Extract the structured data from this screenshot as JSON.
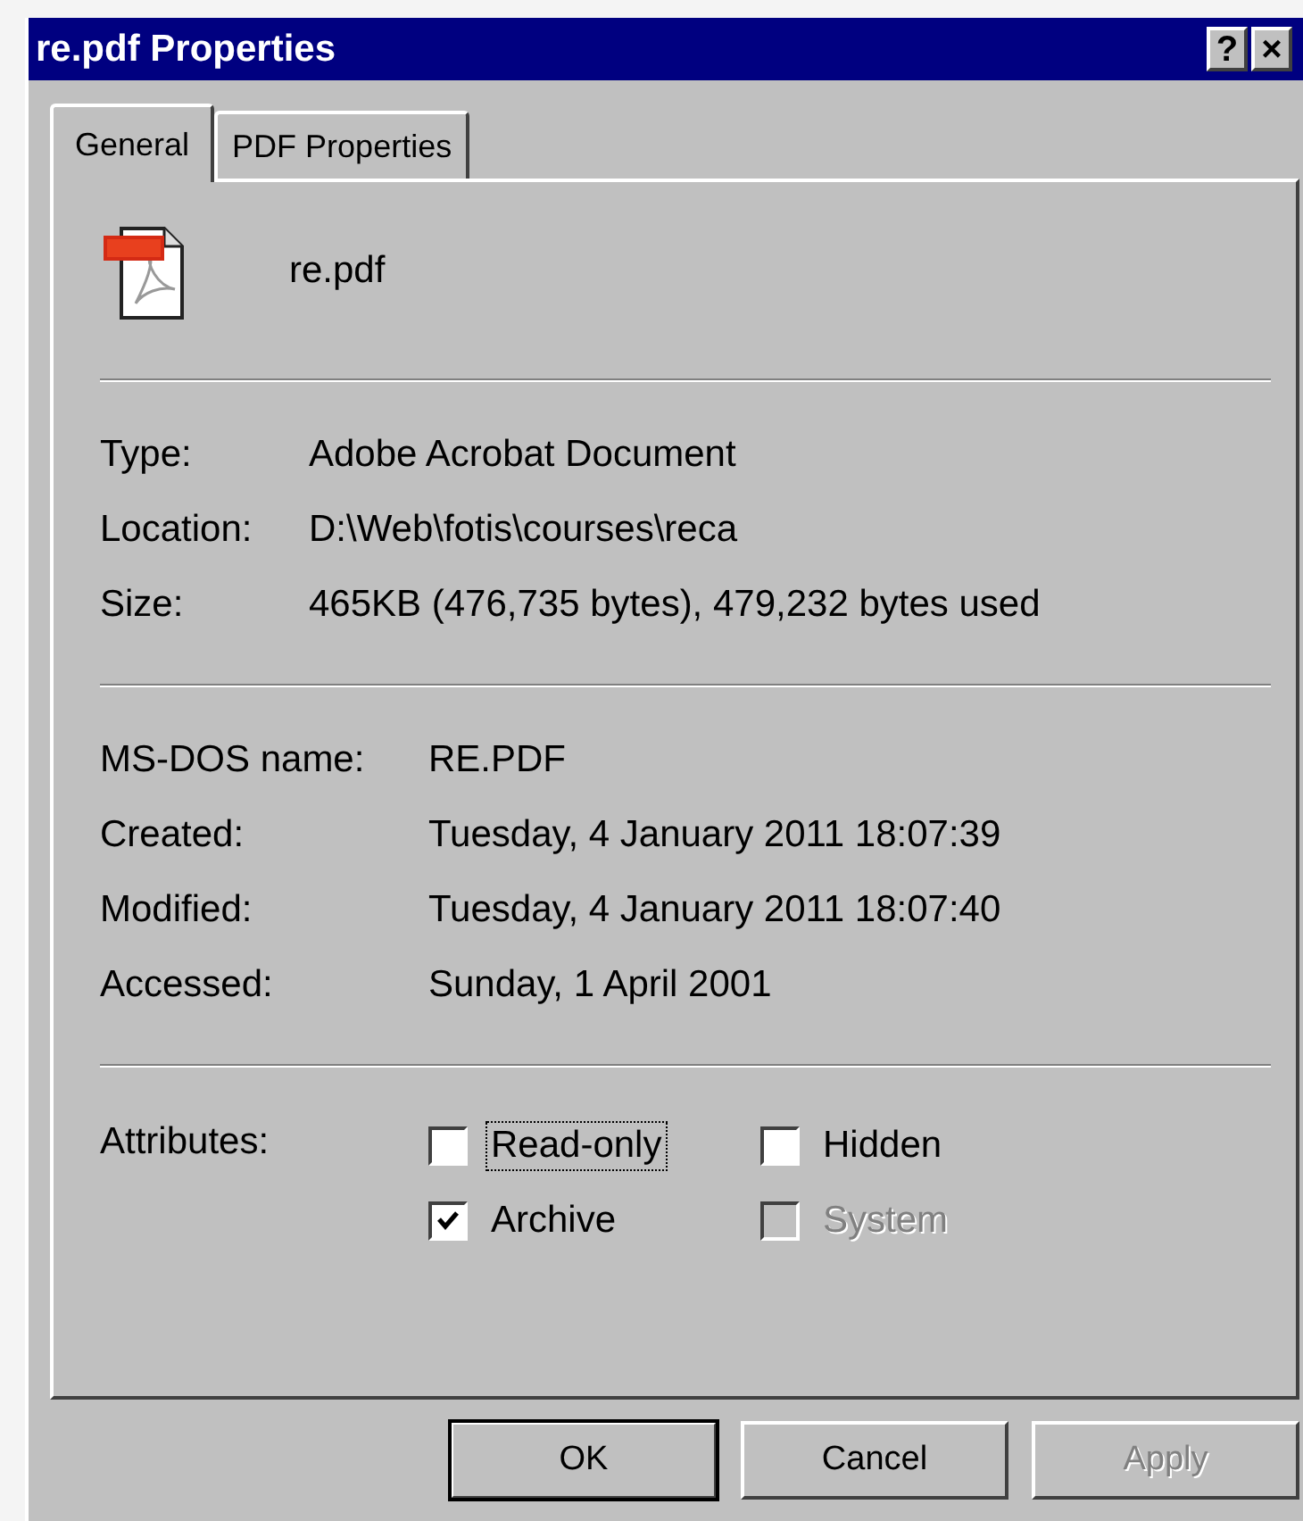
{
  "window": {
    "title": "re.pdf Properties",
    "title_buttons": [
      "?",
      "×"
    ]
  },
  "tabs": [
    {
      "label": "General",
      "selected": true
    },
    {
      "label": "PDF Properties",
      "selected": false
    }
  ],
  "file": {
    "name": "re.pdf"
  },
  "sections": [
    [
      {
        "label": "Type:",
        "value": "Adobe Acrobat Document"
      },
      {
        "label": "Location:",
        "value": "D:\\Web\\fotis\\courses\\reca"
      },
      {
        "label": "Size:",
        "value": "465KB (476,735 bytes), 479,232 bytes used"
      }
    ],
    [
      {
        "label": "MS-DOS name:",
        "value": "RE.PDF"
      },
      {
        "label": "Created:",
        "value": "Tuesday, 4 January 2011 18:07:39"
      },
      {
        "label": "Modified:",
        "value": "Tuesday, 4 January 2011 18:07:40"
      },
      {
        "label": "Accessed:",
        "value": "Sunday, 1 April 2001"
      }
    ]
  ],
  "attributes": {
    "label": "Attributes:",
    "items": [
      {
        "label": "Read-only",
        "checked": false,
        "disabled": false,
        "focused": true
      },
      {
        "label": "Hidden",
        "checked": false,
        "disabled": false,
        "focused": false
      },
      {
        "label": "Archive",
        "checked": true,
        "disabled": false,
        "focused": false
      },
      {
        "label": "System",
        "checked": false,
        "disabled": true,
        "focused": false
      }
    ]
  },
  "buttons": [
    {
      "label": "OK",
      "disabled": false,
      "default": true
    },
    {
      "label": "Cancel",
      "disabled": false,
      "default": false
    },
    {
      "label": "Apply",
      "disabled": true,
      "default": false
    }
  ]
}
